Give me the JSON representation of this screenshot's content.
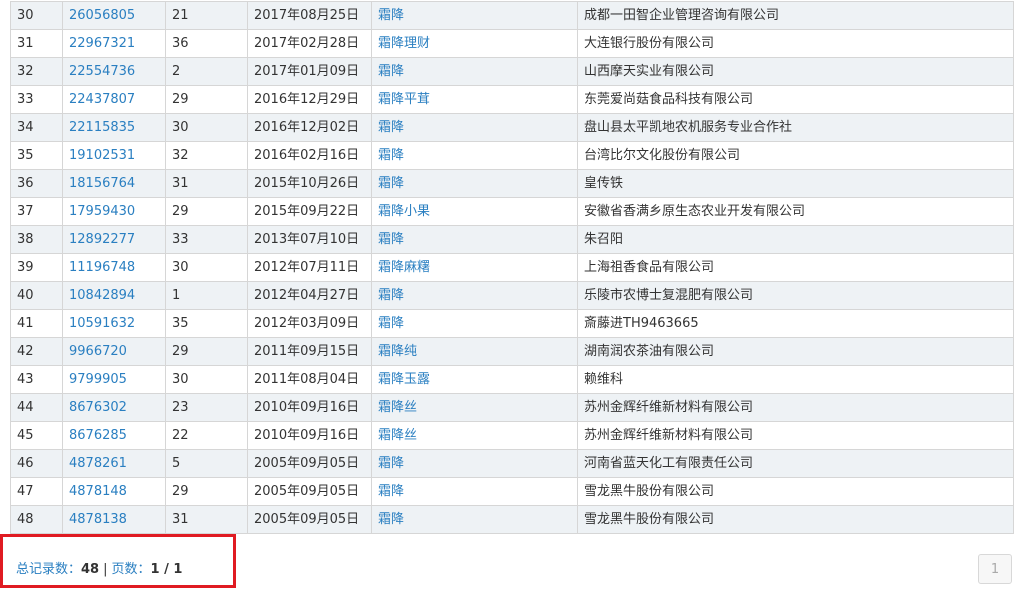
{
  "rows": [
    {
      "idx": "30",
      "reg_no": "26056805",
      "cls": "21",
      "date": "2017年08月25日",
      "name": "霜降",
      "applicant": "成都一田智企业管理咨询有限公司"
    },
    {
      "idx": "31",
      "reg_no": "22967321",
      "cls": "36",
      "date": "2017年02月28日",
      "name": "霜降理财",
      "applicant": "大连银行股份有限公司"
    },
    {
      "idx": "32",
      "reg_no": "22554736",
      "cls": "2",
      "date": "2017年01月09日",
      "name": "霜降",
      "applicant": "山西摩天实业有限公司"
    },
    {
      "idx": "33",
      "reg_no": "22437807",
      "cls": "29",
      "date": "2016年12月29日",
      "name": "霜降平茸",
      "applicant": "东莞爱尚菇食品科技有限公司"
    },
    {
      "idx": "34",
      "reg_no": "22115835",
      "cls": "30",
      "date": "2016年12月02日",
      "name": "霜降",
      "applicant": "盘山县太平凯地农机服务专业合作社"
    },
    {
      "idx": "35",
      "reg_no": "19102531",
      "cls": "32",
      "date": "2016年02月16日",
      "name": "霜降",
      "applicant": "台湾比尔文化股份有限公司"
    },
    {
      "idx": "36",
      "reg_no": "18156764",
      "cls": "31",
      "date": "2015年10月26日",
      "name": "霜降",
      "applicant": "皇传铁"
    },
    {
      "idx": "37",
      "reg_no": "17959430",
      "cls": "29",
      "date": "2015年09月22日",
      "name": "霜降小果",
      "applicant": "安徽省香满乡原生态农业开发有限公司"
    },
    {
      "idx": "38",
      "reg_no": "12892277",
      "cls": "33",
      "date": "2013年07月10日",
      "name": "霜降",
      "applicant": "朱召阳"
    },
    {
      "idx": "39",
      "reg_no": "11196748",
      "cls": "30",
      "date": "2012年07月11日",
      "name": "霜降麻糬",
      "applicant": "上海祖香食品有限公司"
    },
    {
      "idx": "40",
      "reg_no": "10842894",
      "cls": "1",
      "date": "2012年04月27日",
      "name": "霜降",
      "applicant": "乐陵市农博士复混肥有限公司"
    },
    {
      "idx": "41",
      "reg_no": "10591632",
      "cls": "35",
      "date": "2012年03月09日",
      "name": "霜降",
      "applicant": "斎藤进TH9463665"
    },
    {
      "idx": "42",
      "reg_no": "9966720",
      "cls": "29",
      "date": "2011年09月15日",
      "name": "霜降纯",
      "applicant": "湖南润农茶油有限公司"
    },
    {
      "idx": "43",
      "reg_no": "9799905",
      "cls": "30",
      "date": "2011年08月04日",
      "name": "霜降玉露",
      "applicant": "赖维科"
    },
    {
      "idx": "44",
      "reg_no": "8676302",
      "cls": "23",
      "date": "2010年09月16日",
      "name": "霜降丝",
      "applicant": "苏州金辉纤维新材料有限公司"
    },
    {
      "idx": "45",
      "reg_no": "8676285",
      "cls": "22",
      "date": "2010年09月16日",
      "name": "霜降丝",
      "applicant": "苏州金辉纤维新材料有限公司"
    },
    {
      "idx": "46",
      "reg_no": "4878261",
      "cls": "5",
      "date": "2005年09月05日",
      "name": "霜降",
      "applicant": "河南省蓝天化工有限责任公司"
    },
    {
      "idx": "47",
      "reg_no": "4878148",
      "cls": "29",
      "date": "2005年09月05日",
      "name": "霜降",
      "applicant": "雪龙黑牛股份有限公司"
    },
    {
      "idx": "48",
      "reg_no": "4878138",
      "cls": "31",
      "date": "2005年09月05日",
      "name": "霜降",
      "applicant": "雪龙黑牛股份有限公司"
    }
  ],
  "footer": {
    "total_label": "总记录数：",
    "total_value": "48",
    "separator": "|",
    "pages_label": "页数：",
    "pages_value": "1 / 1"
  },
  "pagination": {
    "current": "1"
  },
  "colors": {
    "link": "#2a7fc1",
    "highlight_border": "#e01b22",
    "row_alt": "#eef2f5"
  }
}
